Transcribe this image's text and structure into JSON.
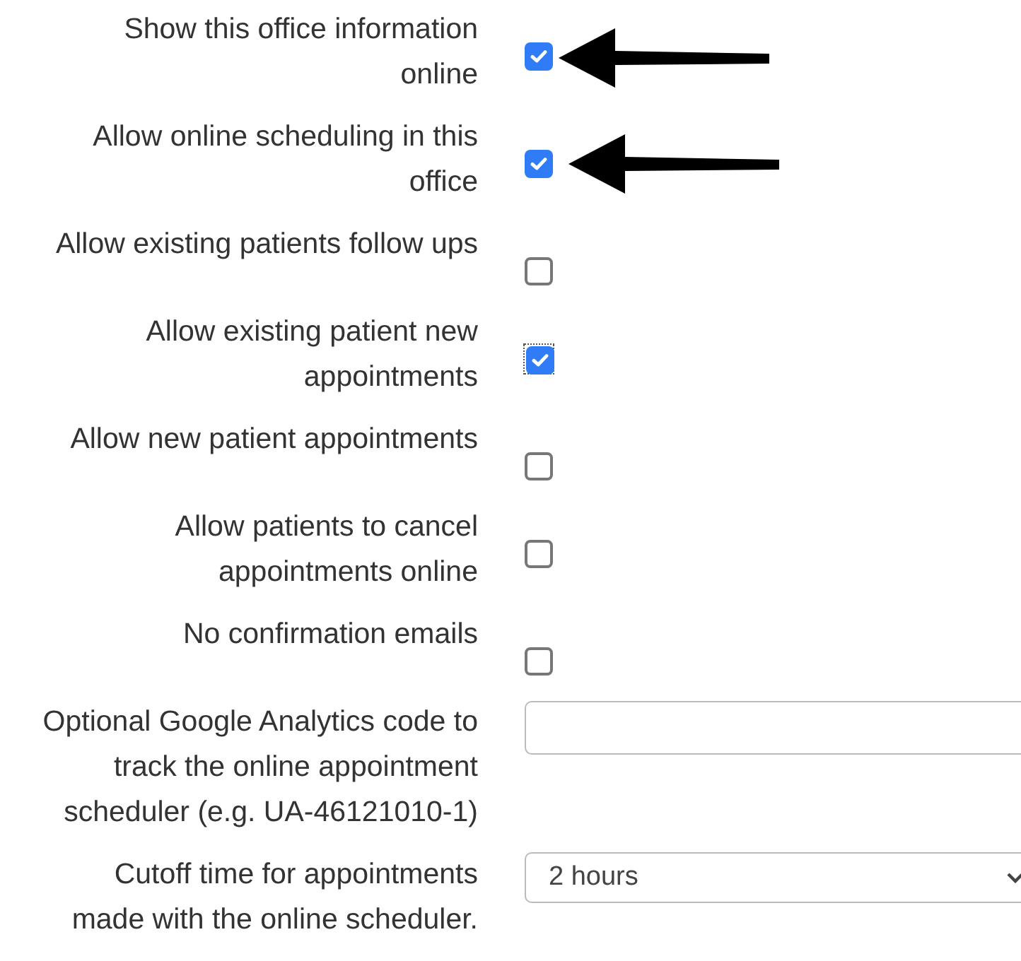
{
  "settings": [
    {
      "kind": "checkbox",
      "label": "Show this office information\nonline",
      "checked": true,
      "focused": false,
      "arrow": true
    },
    {
      "kind": "checkbox",
      "label": "Allow online scheduling in this\noffice",
      "checked": true,
      "focused": false,
      "arrow": true
    },
    {
      "kind": "checkbox",
      "label": "Allow existing patients follow ups",
      "checked": false,
      "focused": false,
      "arrow": false
    },
    {
      "kind": "checkbox",
      "label": "Allow existing patient new\nappointments",
      "checked": true,
      "focused": true,
      "arrow": false
    },
    {
      "kind": "checkbox",
      "label": "Allow new patient appointments",
      "checked": false,
      "focused": false,
      "arrow": false
    },
    {
      "kind": "checkbox",
      "label": "Allow patients to cancel\nappointments online",
      "checked": false,
      "focused": false,
      "arrow": false
    },
    {
      "kind": "checkbox",
      "label": "No confirmation emails",
      "checked": false,
      "focused": false,
      "arrow": false
    },
    {
      "kind": "text",
      "label": "Optional Google Analytics code to\ntrack the online appointment\nscheduler (e.g. UA-46121010-1)"
    },
    {
      "kind": "select",
      "label": "Cutoff time for appointments\nmade with the online scheduler.",
      "value": "2 hours"
    }
  ]
}
